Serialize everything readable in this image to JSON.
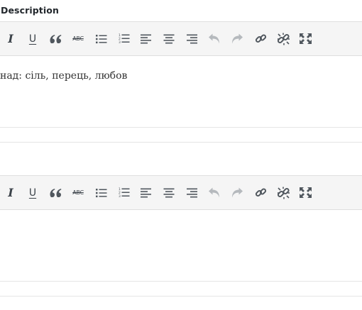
{
  "section": {
    "title": "Description"
  },
  "editor1": {
    "content": "над: сіль, перець, любов"
  },
  "toolbar": {
    "buttons": [
      {
        "name": "italic-button",
        "icon": "italic-icon",
        "glyph": "I"
      },
      {
        "name": "underline-button",
        "icon": "underline-icon",
        "glyph": "U"
      },
      {
        "name": "blockquote-button",
        "icon": "quote-icon"
      },
      {
        "name": "strikethrough-button",
        "icon": "strikethrough-icon",
        "glyph": "ABC"
      },
      {
        "name": "bullet-list-button",
        "icon": "bullet-list-icon"
      },
      {
        "name": "numbered-list-button",
        "icon": "numbered-list-icon"
      },
      {
        "name": "align-left-button",
        "icon": "align-left-icon"
      },
      {
        "name": "align-center-button",
        "icon": "align-center-icon"
      },
      {
        "name": "align-right-button",
        "icon": "align-right-icon"
      },
      {
        "name": "undo-button",
        "icon": "undo-icon",
        "disabled": true
      },
      {
        "name": "redo-button",
        "icon": "redo-icon",
        "disabled": true
      },
      {
        "name": "insert-link-button",
        "icon": "link-icon"
      },
      {
        "name": "remove-link-button",
        "icon": "unlink-icon"
      },
      {
        "name": "fullscreen-button",
        "icon": "fullscreen-icon"
      }
    ]
  },
  "colors": {
    "toolbar_bg": "#f5f5f5",
    "icon": "#3c434a",
    "icon_disabled": "#b5b9bd",
    "border": "#dedede"
  }
}
